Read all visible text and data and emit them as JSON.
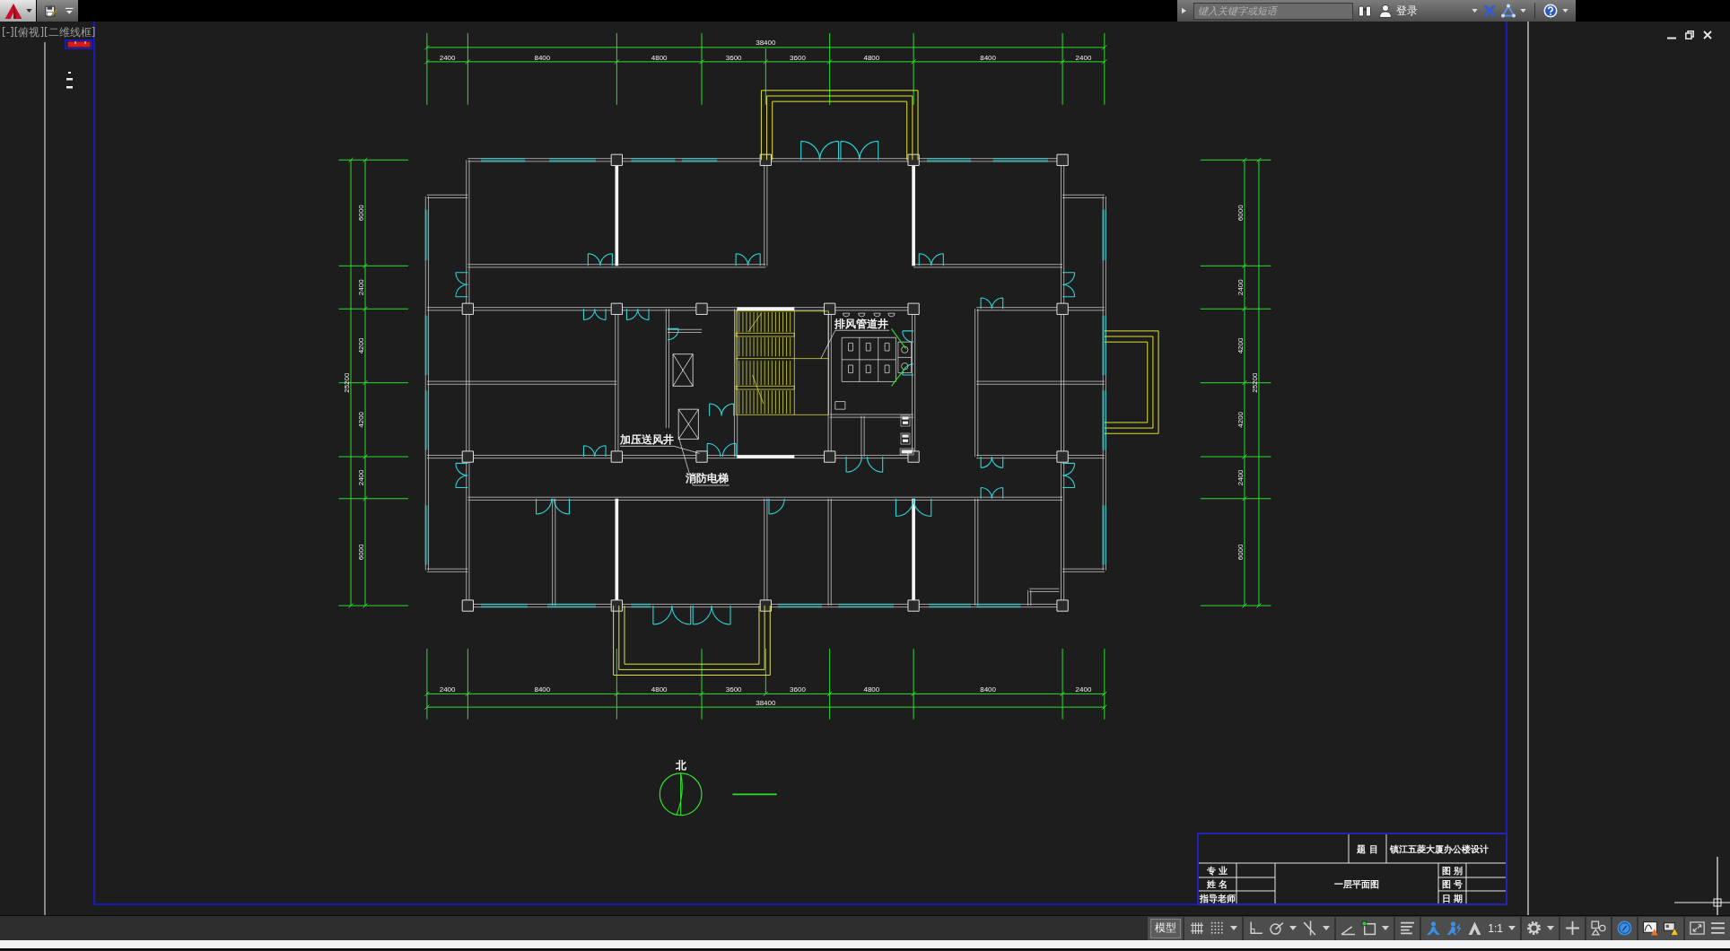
{
  "title_bar": {
    "search": {
      "placeholder": "键入关键字或短语"
    },
    "sign_in": "登录"
  },
  "viewport": {
    "label": "[-][俯视][二维线框]"
  },
  "drawing": {
    "dimensions": {
      "top": {
        "total": "38400",
        "segments": [
          "2400",
          "8400",
          "4800",
          "3600",
          "3600",
          "4800",
          "8400",
          "2400"
        ]
      },
      "bottom": {
        "total": "38400",
        "segments": [
          "2400",
          "8400",
          "4800",
          "3600",
          "3600",
          "4800",
          "8400",
          "2400"
        ]
      },
      "left": {
        "total": "25200",
        "segments": [
          "6000",
          "2400",
          "4200",
          "4200",
          "2400",
          "6000"
        ]
      },
      "right": {
        "total": "25200",
        "segments": [
          "6000",
          "2400",
          "4200",
          "4200",
          "2400",
          "6000"
        ]
      }
    },
    "labels": [
      "排风管道井",
      "加压送风井",
      "消防电梯"
    ],
    "north_arrow": {
      "label": "北"
    }
  },
  "title_block": {
    "heading": "题 目",
    "project": "镇江五菱大厦办公楼设计",
    "left_fields": [
      "专 业",
      "姓 名",
      "指导老师"
    ],
    "drawing_title": "一层平面图",
    "right_fields": [
      "图 别",
      "图 号",
      "日 期"
    ]
  },
  "status_bar": {
    "items": [
      {
        "kind": "model-tab",
        "label": "模型"
      },
      {
        "kind": "separator"
      },
      {
        "kind": "grid",
        "on": false
      },
      {
        "kind": "snap",
        "on": false,
        "dropdown": true
      },
      {
        "kind": "separator"
      },
      {
        "kind": "ortho",
        "on": false
      },
      {
        "kind": "polar",
        "on": false,
        "dropdown": true
      },
      {
        "kind": "isodraft",
        "on": false,
        "dropdown": true
      },
      {
        "kind": "separator"
      },
      {
        "kind": "angle",
        "on": false
      },
      {
        "kind": "osnap",
        "on": false,
        "dropdown": true
      },
      {
        "kind": "separator"
      },
      {
        "kind": "lineweight",
        "on": false
      },
      {
        "kind": "separator"
      },
      {
        "kind": "annotation-visibility",
        "on": true
      },
      {
        "kind": "auto-scale",
        "on": true
      },
      {
        "kind": "annotation-scale",
        "on": false
      },
      {
        "kind": "scale-list",
        "label": "1:1",
        "dropdown": true
      },
      {
        "kind": "separator"
      },
      {
        "kind": "workspace",
        "dropdown": true
      },
      {
        "kind": "separator"
      },
      {
        "kind": "annotation-monitor",
        "on": false
      },
      {
        "kind": "separator"
      },
      {
        "kind": "shapes"
      },
      {
        "kind": "separator"
      },
      {
        "kind": "isolate",
        "on": true
      },
      {
        "kind": "separator"
      },
      {
        "kind": "performance"
      },
      {
        "kind": "hardware"
      },
      {
        "kind": "separator"
      },
      {
        "kind": "fullscreen"
      },
      {
        "kind": "menu"
      }
    ]
  }
}
